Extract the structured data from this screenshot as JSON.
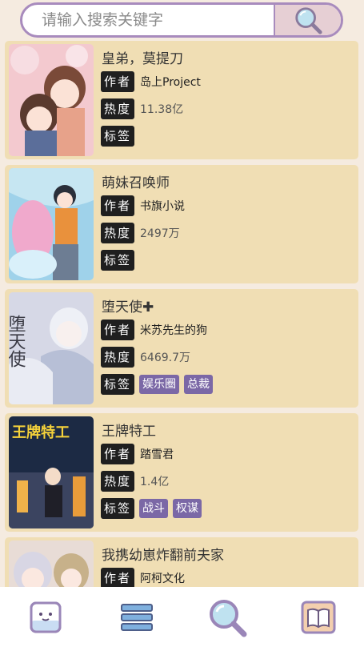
{
  "search": {
    "placeholder": "请输入搜索关键字"
  },
  "labels": {
    "author": "作者",
    "heat": "热度",
    "tags": "标签"
  },
  "comics": [
    {
      "title": "皇弟，莫提刀",
      "author": "岛上Project",
      "heat": "11.38亿",
      "tags": []
    },
    {
      "title": "萌妹召唤师",
      "author": "书旗小说",
      "heat": "2497万",
      "tags": []
    },
    {
      "title": "堕天使✚",
      "author": "米苏先生的狗",
      "heat": "6469.7万",
      "tags": [
        "娱乐圈",
        "总裁"
      ]
    },
    {
      "title": "王牌特工",
      "author": "踏雪君",
      "heat": "1.4亿",
      "tags": [
        "战斗",
        "权谋"
      ]
    },
    {
      "title": "我携幼崽炸翻前夫家",
      "author": "阿柯文化",
      "heat": "",
      "tags": []
    }
  ],
  "covers": {
    "cover4_text": "王牌特工",
    "cover3_text": "堕天使"
  },
  "nav": [
    {
      "icon": "mascot-icon"
    },
    {
      "icon": "menu-list-icon"
    },
    {
      "icon": "search-icon"
    },
    {
      "icon": "book-icon"
    }
  ]
}
